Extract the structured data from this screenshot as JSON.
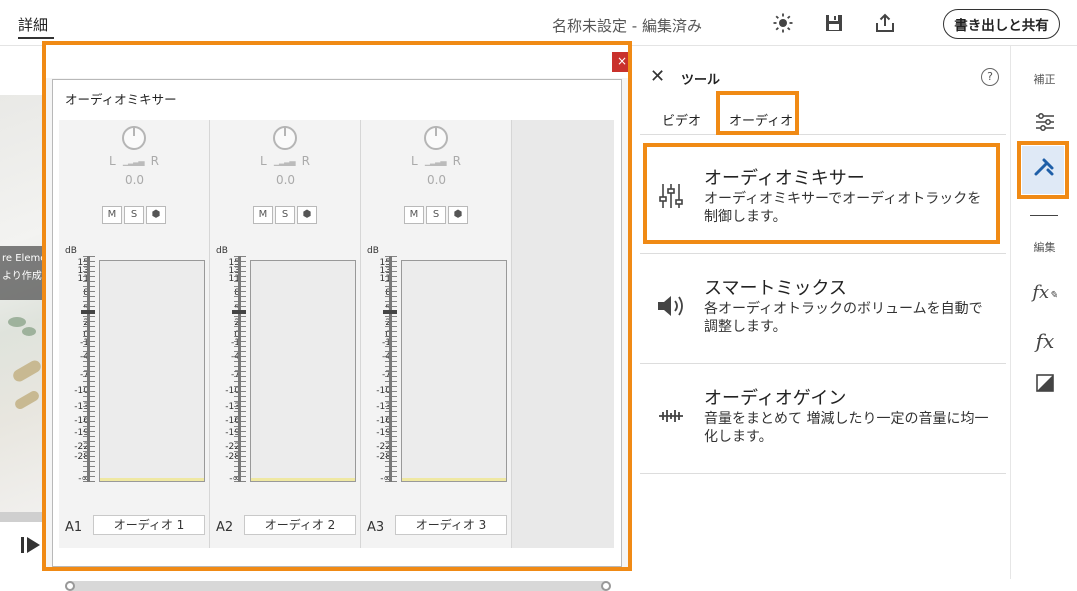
{
  "topbar": {
    "detail_label": "詳細",
    "doc_title": "名称未設定 - 編集済み",
    "export_button": "書き出しと共有",
    "icons": [
      "brightness-icon",
      "save-icon",
      "share-icon"
    ]
  },
  "preview": {
    "caption_line1": "re Eleme",
    "caption_line2": "より作成"
  },
  "mixer": {
    "title": "オーディオミキサー",
    "close_label": "×",
    "pan_left": "L",
    "pan_right": "R",
    "mute_label": "M",
    "solo_label": "S",
    "db_label": "dB",
    "db_ticks": [
      "15",
      "13",
      "11",
      "8",
      "5",
      "2",
      "0",
      "-1",
      "-4",
      "-7",
      "-10",
      "-13",
      "-16",
      "-19",
      "-22",
      "-28",
      "-∞"
    ],
    "tracks": [
      {
        "id": "A1",
        "name": "オーディオ 1",
        "pan": "0.0"
      },
      {
        "id": "A2",
        "name": "オーディオ 2",
        "pan": "0.0"
      },
      {
        "id": "A3",
        "name": "オーディオ 3",
        "pan": "0.0"
      }
    ]
  },
  "tools": {
    "title": "ツール",
    "help": "?",
    "tabs": [
      {
        "label": "ビデオ",
        "active": false
      },
      {
        "label": "オーディオ",
        "active": true
      }
    ],
    "items": [
      {
        "name": "オーディオミキサー",
        "desc": "オーディオミキサーでオーディオトラックを制御します。",
        "icon": "mixer-sliders-icon",
        "highlighted": true
      },
      {
        "name": "スマートミックス",
        "desc": "各オーディオトラックのボリュームを自動で調整します。",
        "icon": "speaker-icon",
        "highlighted": false
      },
      {
        "name": "オーディオゲイン",
        "desc": "音量をまとめて 増減したり一定の音量に均一化します。",
        "icon": "waveform-icon",
        "highlighted": false
      }
    ]
  },
  "rail": {
    "section_adjust": "補正",
    "section_edit": "編集",
    "icons": [
      "adjust-sliders-icon",
      "tools-icon",
      "fx-edit-icon",
      "fx-icon",
      "color-icon"
    ]
  },
  "accent": "#f08a15"
}
